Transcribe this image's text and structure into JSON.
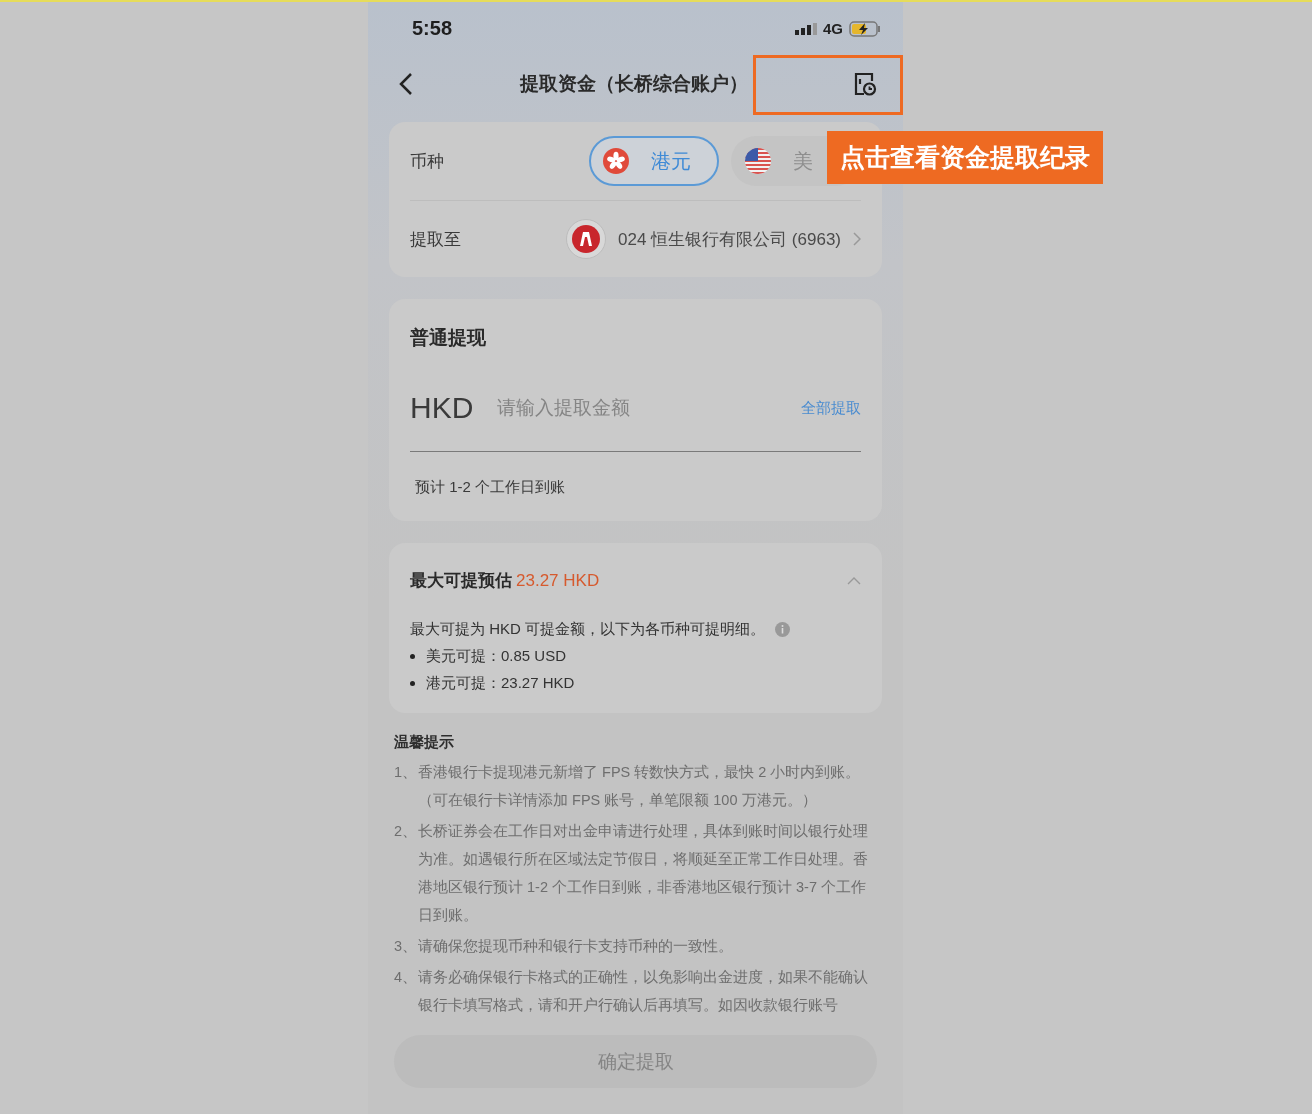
{
  "status_bar": {
    "time": "5:58",
    "network": "4G"
  },
  "nav": {
    "title": "提取资金（长桥综合账户）"
  },
  "annotation": {
    "label": "点击查看资金提取纪录"
  },
  "currency": {
    "label": "币种",
    "options": [
      {
        "name": "港元",
        "kind": "hk",
        "selected": true
      },
      {
        "name": "美",
        "kind": "us",
        "selected": false
      }
    ]
  },
  "destination": {
    "label": "提取至",
    "bank": "024 恒生银行有限公司 (6963)"
  },
  "withdraw": {
    "title": "普通提现",
    "currency": "HKD",
    "placeholder": "请输入提取金额",
    "all_link": "全部提取",
    "eta": "预计 1-2 个工作日到账"
  },
  "max": {
    "label": "最大可提预估",
    "amount": "23.27 HKD",
    "expanded": true,
    "description": "最大可提为 HKD 可提金额，以下为各币种可提明细。",
    "items": [
      "美元可提：0.85 USD",
      "港元可提：23.27 HKD"
    ]
  },
  "notes": {
    "title": "温馨提示",
    "items": [
      {
        "number": "1、",
        "text": "香港银行卡提现港元新增了 FPS 转数快方式，最快 2 小时内到账。（可在银行卡详情添加 FPS 账号，单笔限额 100 万港元。）"
      },
      {
        "number": "2、",
        "text": "长桥证券会在工作日对出金申请进行处理，具体到账时间以银行处理为准。如遇银行所在区域法定节假日，将顺延至正常工作日处理。香港地区银行预计 1-2 个工作日到账，非香港地区银行预计 3-7 个工作日到账。"
      },
      {
        "number": "3、",
        "text": "请确保您提现币种和银行卡支持币种的一致性。"
      },
      {
        "number": "4、",
        "text": "请务必确保银行卡格式的正确性，以免影响出金进度，如果不能确认银行卡填写格式，请和开户行确认后再填写。如因收款银行账号"
      }
    ]
  },
  "submit": {
    "label": "确定提取",
    "disabled": true
  }
}
